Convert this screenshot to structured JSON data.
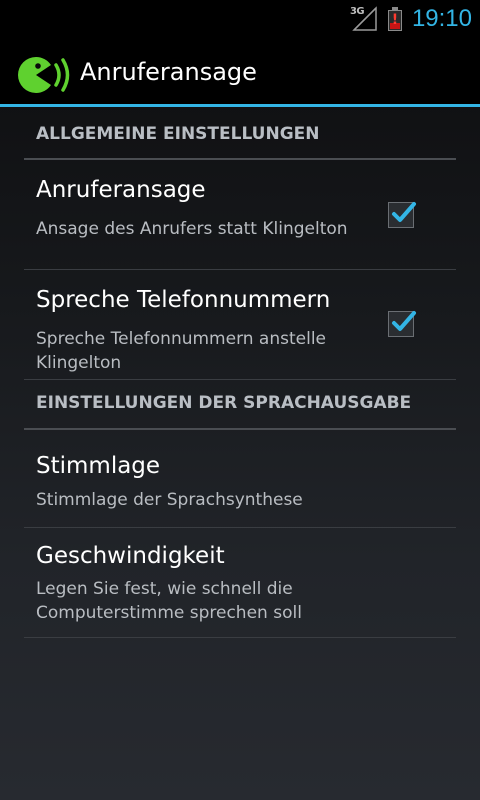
{
  "status_bar": {
    "network": "3G",
    "time": "19:10",
    "battery_alert": "!"
  },
  "action_bar": {
    "title": "Anruferansage"
  },
  "categories": [
    {
      "label": "ALLGEMEINE EINSTELLUNGEN",
      "items": [
        {
          "title": "Anruferansage",
          "summary": "Ansage des Anrufers statt Klingelton",
          "checked": true
        },
        {
          "title": "Spreche Telefonnummern",
          "summary": "Spreche Telefonnummern anstelle Klingelton",
          "checked": true
        }
      ]
    },
    {
      "label": "EINSTELLUNGEN DER SPRACHAUSGABE",
      "items": [
        {
          "title": "Stimmlage",
          "summary": "Stimmlage der Sprachsynthese"
        },
        {
          "title": "Geschwindigkeit",
          "summary": "Legen Sie fest, wie schnell die Computerstimme sprechen soll"
        }
      ]
    }
  ],
  "colors": {
    "accent": "#33b5e5",
    "app_icon": "#5fd12f",
    "battery_alert": "#ff3b30"
  }
}
